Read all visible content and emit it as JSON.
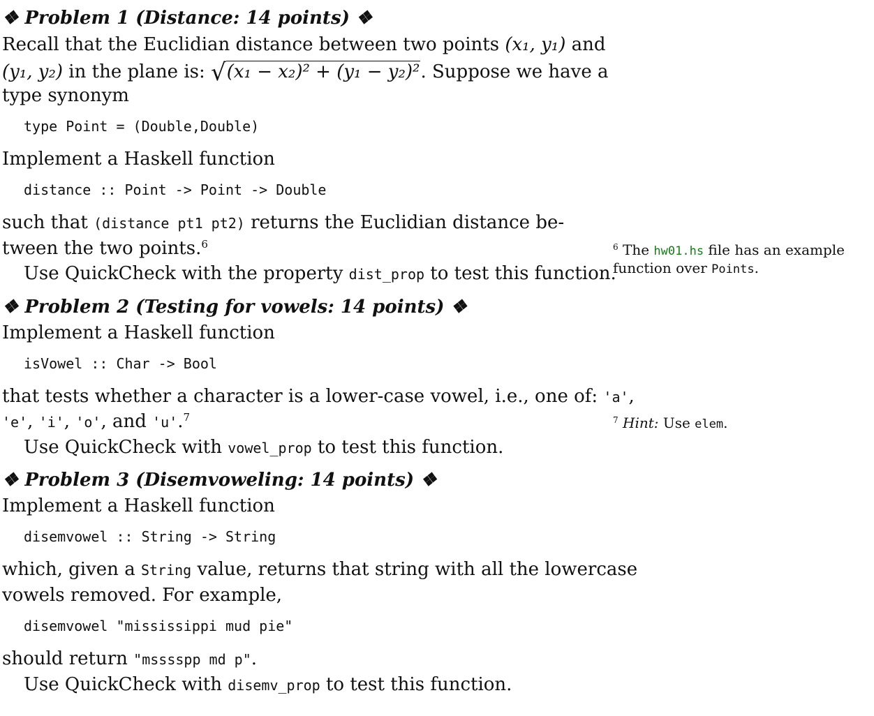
{
  "p1": {
    "heading": "❖ Problem 1 (Distance: 14 points) ❖",
    "intro_a": "Recall that the Euclidian distance between two points ",
    "point_a": "(x₁, y₁)",
    "and_text": " and",
    "point_b": "(y₁, y₂)",
    "in_plane": " in the plane is: ",
    "formula_sqrt": "√",
    "formula_body": "(x₁ − x₂)² + (y₁ − y₂)²",
    "suppose": ". Suppose we have a",
    "type_synonym": "type synonym",
    "code1": "type Point = (Double,Double)",
    "impl": "Implement a Haskell function",
    "code2": "distance :: Point -> Point -> Double",
    "such_a": "such that ",
    "such_code": "(distance pt1 pt2)",
    "such_b": " returns the Euclidian distance be-",
    "tween": "tween the two points.",
    "fn_mark": "6",
    "use_a": "Use QuickCheck with the property ",
    "use_code": "dist_prop",
    "use_b": " to test this function.",
    "note_mark": "6",
    "note_a": " The ",
    "note_code": "hw01.hs",
    "note_b": " file has an example",
    "note_c": "function over ",
    "note_code2": "Points",
    "note_d": "."
  },
  "p2": {
    "heading": "❖ Problem 2 (Testing for vowels: 14 points) ❖",
    "impl": "Implement a Haskell function",
    "code1": "isVowel :: Char -> Bool",
    "tests_a": "that tests whether a character is a lower-case vowel, i.e., one of: ",
    "v_a": "'a'",
    "comma1": ",",
    "v_e": "'e'",
    "comma2": ", ",
    "v_i": "'i'",
    "comma3": ", ",
    "v_o": "'o'",
    "and_text": ", and ",
    "v_u": "'u'",
    "period": ".",
    "fn_mark": "7",
    "use_a": "Use QuickCheck with ",
    "use_code": "vowel_prop",
    "use_b": " to test this function.",
    "note_mark": "7",
    "note_hint": " Hint:",
    "note_a": " Use ",
    "note_code": "elem",
    "note_b": "."
  },
  "p3": {
    "heading": "❖ Problem 3 (Disemvoweling: 14 points) ❖",
    "impl": "Implement a Haskell function",
    "code1": "disemvowel :: String -> String",
    "which_a": "which, given a ",
    "which_code": "String",
    "which_b": " value, returns that string with all the lowercase",
    "vowels": "vowels removed. For example,",
    "code2": "disemvowel \"mississippi mud pie\"",
    "should_a": "should return ",
    "should_code": "\"msssspp md p\"",
    "should_b": ".",
    "use_a": "Use QuickCheck with ",
    "use_code": "disemv_prop",
    "use_b": " to test this function."
  }
}
